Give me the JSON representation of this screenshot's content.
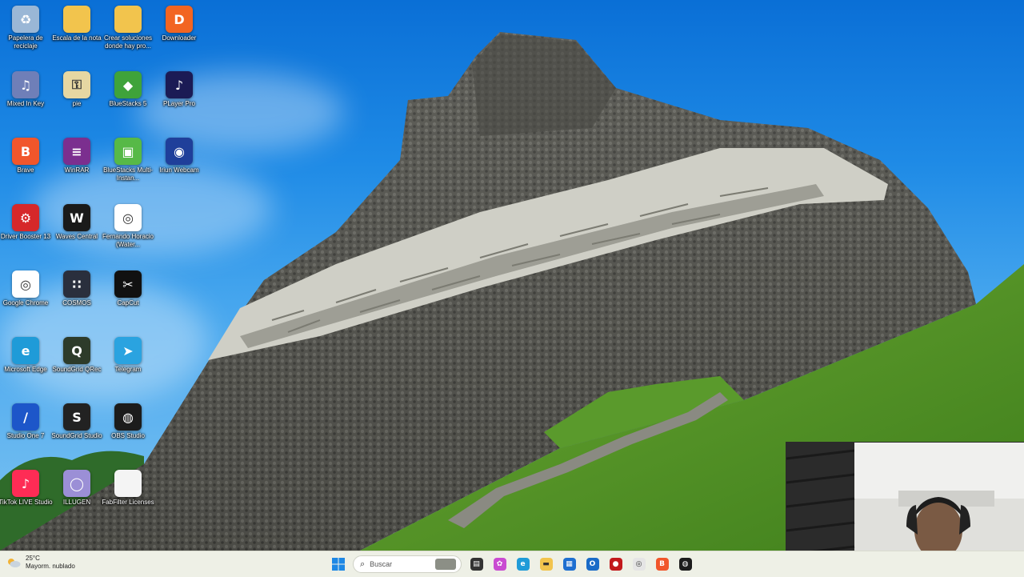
{
  "desktop": {
    "icons": [
      {
        "label": "Papelera de reciclaje",
        "icon": "recycle-bin-icon",
        "color": "#9ab7d6",
        "glyph": "♻"
      },
      {
        "label": "Escala de la nota",
        "icon": "folder-icon",
        "color": "#f2c44d",
        "glyph": ""
      },
      {
        "label": "Crear soluciones donde hay pro...",
        "icon": "folder-icon",
        "color": "#f2c44d",
        "glyph": ""
      },
      {
        "label": "Downloader",
        "icon": "downloader-icon",
        "color": "#f26522",
        "glyph": "D"
      },
      {
        "label": "Mixed In Key",
        "icon": "mixed-in-key-icon",
        "color": "#6f7fb8",
        "glyph": "♫"
      },
      {
        "label": "pie",
        "icon": "key-file-icon",
        "color": "#e6d7a2",
        "glyph": "⚿"
      },
      {
        "label": "BlueStacks 5",
        "icon": "bluestacks-icon",
        "color": "#3fa33a",
        "glyph": "◆"
      },
      {
        "label": "PLayer Pro",
        "icon": "player-pro-icon",
        "color": "#1b1b55",
        "glyph": "♪"
      },
      {
        "label": "Brave",
        "icon": "brave-icon",
        "color": "#f1562b",
        "glyph": "B"
      },
      {
        "label": "WinRAR",
        "icon": "winrar-icon",
        "color": "#7b2f8f",
        "glyph": "≡"
      },
      {
        "label": "BlueStacks Multi-Instan...",
        "icon": "bluestacks-multi-icon",
        "color": "#57b947",
        "glyph": "▣"
      },
      {
        "label": "Iriun Webcam",
        "icon": "iriun-webcam-icon",
        "color": "#1f3f9a",
        "glyph": "◉"
      },
      {
        "label": "Driver Booster 13",
        "icon": "driver-booster-icon",
        "color": "#d6282a",
        "glyph": "⚙"
      },
      {
        "label": "Waves Central",
        "icon": "waves-central-icon",
        "color": "#1a1a1a",
        "glyph": "W"
      },
      {
        "label": "Fernando Horacio (Water...",
        "icon": "chrome-profile-icon",
        "color": "#ffffff",
        "glyph": "◎"
      },
      {
        "label": "",
        "icon": "",
        "color": "",
        "glyph": ""
      },
      {
        "label": "Google Chrome",
        "icon": "chrome-icon",
        "color": "#ffffff",
        "glyph": "◎"
      },
      {
        "label": "COSMOS",
        "icon": "cosmos-icon",
        "color": "#2a2f3d",
        "glyph": "∷"
      },
      {
        "label": "CapCut",
        "icon": "capcut-icon",
        "color": "#111111",
        "glyph": "✂"
      },
      {
        "label": "",
        "icon": "",
        "color": "",
        "glyph": ""
      },
      {
        "label": "Microsoft Edge",
        "icon": "edge-icon",
        "color": "#1f9bd8",
        "glyph": "e"
      },
      {
        "label": "SoundGrid QRec",
        "icon": "soundgrid-qrec-icon",
        "color": "#2d3b2a",
        "glyph": "Q"
      },
      {
        "label": "Telegram",
        "icon": "telegram-icon",
        "color": "#2aa3e0",
        "glyph": "➤"
      },
      {
        "label": "",
        "icon": "",
        "color": "",
        "glyph": ""
      },
      {
        "label": "Studio One 7",
        "icon": "studio-one-icon",
        "color": "#1d56c9",
        "glyph": "/"
      },
      {
        "label": "SoundGrid Studio",
        "icon": "soundgrid-studio-icon",
        "color": "#222222",
        "glyph": "S"
      },
      {
        "label": "OBS Studio",
        "icon": "obs-icon",
        "color": "#1c1c1c",
        "glyph": "◍"
      },
      {
        "label": "",
        "icon": "",
        "color": "",
        "glyph": ""
      },
      {
        "label": "TikTok LIVE Studio",
        "icon": "tiktok-live-icon",
        "color": "#fe2c55",
        "glyph": "♪"
      },
      {
        "label": "ILLUGEN",
        "icon": "illugen-icon",
        "color": "#9b8fd6",
        "glyph": "◯"
      },
      {
        "label": "FabFilter Licenses",
        "icon": "text-file-icon",
        "color": "#f4f4f4",
        "glyph": ""
      }
    ]
  },
  "taskbar": {
    "weather": {
      "temp": "25°C",
      "desc": "Mayorm. nublado",
      "icon": "cloudy-weather-icon"
    },
    "search_placeholder": "Buscar",
    "apps": [
      {
        "icon": "task-view-icon",
        "color": "#333333",
        "glyph": "▤"
      },
      {
        "icon": "copilot-icon",
        "color": "#c94bd1",
        "glyph": "✿"
      },
      {
        "icon": "edge-taskbar-icon",
        "color": "#1f9bd8",
        "glyph": "e"
      },
      {
        "icon": "file-explorer-icon",
        "color": "#f2c44d",
        "glyph": "▬"
      },
      {
        "icon": "store-icon",
        "color": "#1e6fd0",
        "glyph": "▦"
      },
      {
        "icon": "outlook-icon",
        "color": "#1a6bc7",
        "glyph": "O"
      },
      {
        "icon": "driver-booster-taskbar-icon",
        "color": "#c2191c",
        "glyph": "●"
      },
      {
        "icon": "chrome-taskbar-icon",
        "color": "#e5e5e5",
        "glyph": "◎"
      },
      {
        "icon": "brave-taskbar-icon",
        "color": "#f1562b",
        "glyph": "B"
      },
      {
        "icon": "obs-taskbar-icon",
        "color": "#1c1c1c",
        "glyph": "◍"
      }
    ]
  }
}
